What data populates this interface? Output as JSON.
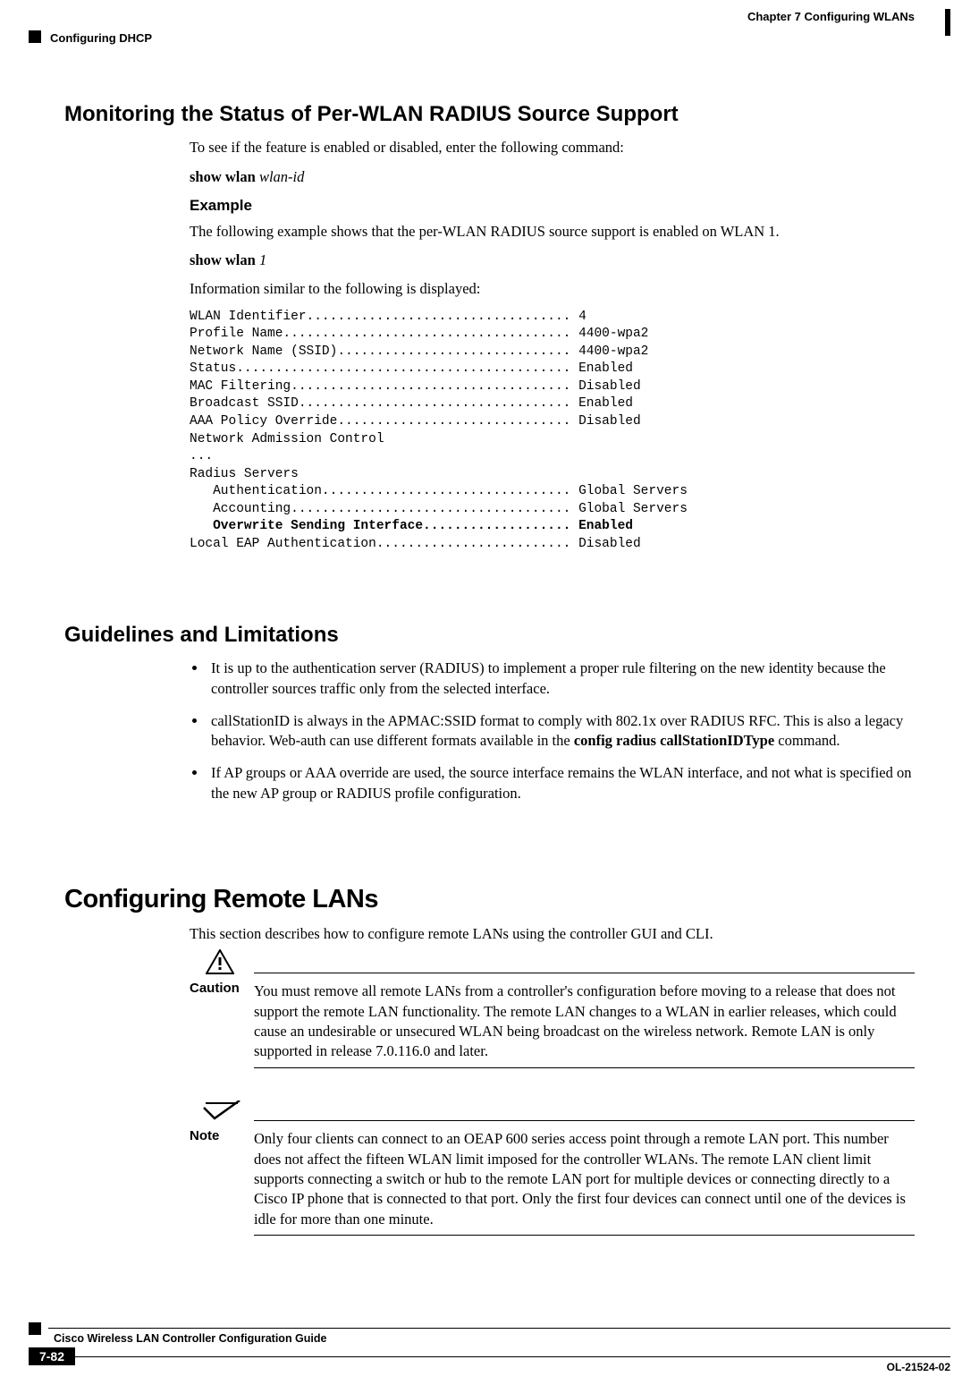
{
  "header": {
    "chapter_line": "Chapter 7      Configuring WLANs",
    "section_line": "Configuring DHCP"
  },
  "s1": {
    "title": "Monitoring the Status of Per-WLAN RADIUS Source Support",
    "p1": "To see if the feature is enabled or disabled, enter the following command:",
    "cmd1_bold": "show wlan",
    "cmd1_ital": "wlan-id",
    "example_label": "Example",
    "p2": "The following example shows that the per-WLAN RADIUS source support is enabled on WLAN 1.",
    "cmd2_bold": "show wlan",
    "cmd2_ital": "1",
    "p3": "Information similar to the following is displayed:",
    "cli_lines": [
      "WLAN Identifier.................................. 4",
      "Profile Name..................................... 4400-wpa2",
      "Network Name (SSID).............................. 4400-wpa2",
      "Status........................................... Enabled",
      "MAC Filtering.................................... Disabled",
      "Broadcast SSID................................... Enabled",
      "AAA Policy Override.............................. Disabled",
      "Network Admission Control",
      "...",
      "Radius Servers",
      "   Authentication................................ Global Servers",
      "   Accounting.................................... Global Servers"
    ],
    "cli_bold_line": "   Overwrite Sending Interface................... Enabled",
    "cli_tail_line": "Local EAP Authentication......................... Disabled"
  },
  "s2": {
    "title": "Guidelines and Limitations",
    "b1": "It is up to the authentication server (RADIUS) to implement a proper rule filtering on the new identity because the controller sources traffic only from the selected interface.",
    "b2_pre": "callStationID is always in the APMAC:SSID format to comply with 802.1x over RADIUS RFC. This is also a legacy behavior. Web-auth can use different formats available in the ",
    "b2_bold": "config radius callStationIDType",
    "b2_post": " command.",
    "b3": "If AP groups or AAA override are used, the source interface remains the WLAN interface, and not what is specified on the new AP group or RADIUS profile configuration."
  },
  "s3": {
    "title": "Configuring Remote LANs",
    "p1": "This section describes how to configure remote LANs using the controller GUI and CLI.",
    "caution_label": "Caution",
    "caution_body": "You must remove all remote LANs from a controller's configuration before moving to a release that does not support the remote LAN functionality. The remote LAN changes to a WLAN in earlier releases, which could cause an undesirable or unsecured WLAN being broadcast on the wireless network. Remote LAN is only supported in release 7.0.116.0 and later.",
    "note_label": "Note",
    "note_body": "Only four clients can connect to an OEAP 600 series access point through a remote LAN port. This number does not affect the fifteen WLAN limit imposed for the controller WLANs. The remote LAN client limit supports connecting a switch or hub to the remote LAN port for multiple devices or connecting directly to a Cisco IP phone that is connected to that port. Only the first four devices can connect until one of the devices is idle for more than one minute."
  },
  "footer": {
    "title": "Cisco Wireless LAN Controller Configuration Guide",
    "page": "7-82",
    "doc": "OL-21524-02"
  }
}
